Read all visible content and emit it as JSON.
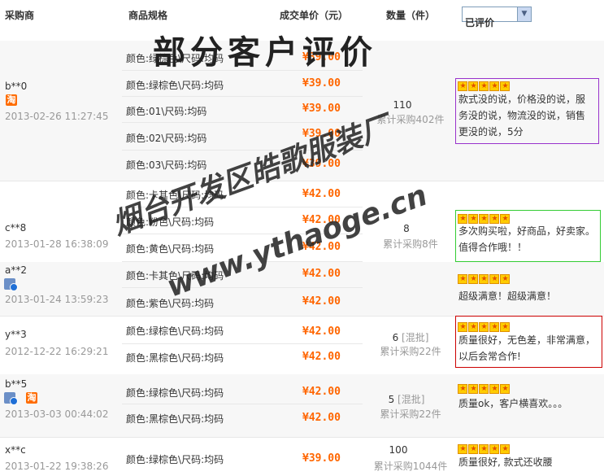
{
  "header": {
    "buyer": "采购商",
    "spec": "商品规格",
    "price": "成交单价（元）",
    "qty": "数量（件）",
    "filter_selected": "已评价"
  },
  "watermark": {
    "title": "部分客户评价",
    "line1": "烟台开发区皓歌服装厂",
    "line2": "www.ythaoge.cn"
  },
  "orders": [
    {
      "buyer": "b**0",
      "badge": "淘",
      "date": "2013-02-26 11:27:45",
      "items": [
        {
          "spec": "颜色:绿棕色\\尺码:均码",
          "price": "¥39.00"
        },
        {
          "spec": "颜色:绿棕色\\尺码:均码",
          "price": "¥39.00"
        },
        {
          "spec": "颜色:01\\尺码:均码",
          "price": "¥39.00"
        },
        {
          "spec": "颜色:02\\尺码:均码",
          "price": "¥39.00"
        },
        {
          "spec": "颜色:03\\尺码:均码",
          "price": "¥39.00"
        }
      ],
      "qty": "110",
      "cumulative": "累计采购402件",
      "comment": "款式没的说，价格没的说，服务没的说，物流没的说，销售更没的说，5分"
    },
    {
      "buyer": "c**8",
      "date": "2013-01-28 16:38:09",
      "items": [
        {
          "spec": "颜色:卡其色\\尺码:均码",
          "price": "¥42.00"
        },
        {
          "spec": "颜色:粉色\\尺码:均码",
          "price": "¥42.00"
        },
        {
          "spec": "颜色:黄色\\尺码:均码",
          "price": "¥42.00"
        }
      ],
      "qty": "8",
      "cumulative": "累计采购8件",
      "comment": "多次购买啦，好商品，好卖家。值得合作哦！！"
    },
    {
      "buyer": "a**2",
      "date": "2013-01-24 13:59:23",
      "items": [
        {
          "spec": "颜色:卡其色\\尺码:均码",
          "price": "¥42.00"
        },
        {
          "spec": "颜色:紫色\\尺码:均码",
          "price": "¥42.00"
        }
      ],
      "comment": "超级满意！超级满意！"
    },
    {
      "buyer": "y**3",
      "date": "2012-12-22 16:29:21",
      "items": [
        {
          "spec": "颜色:绿棕色\\尺码:均码",
          "price": "¥42.00"
        },
        {
          "spec": "颜色:黑棕色\\尺码:均码",
          "price": "¥42.00"
        }
      ],
      "qty": "6",
      "mixed": "[混批]",
      "cumulative": "累计采购22件",
      "comment": "质量很好，无色差，非常满意，以后会常合作!"
    },
    {
      "buyer": "b**5",
      "badge": "淘",
      "date": "2013-03-03 00:44:02",
      "items": [
        {
          "spec": "颜色:绿棕色\\尺码:均码",
          "price": "¥42.00"
        },
        {
          "spec": "颜色:黑棕色\\尺码:均码",
          "price": "¥42.00"
        }
      ],
      "qty": "5",
      "mixed": "[混批]",
      "cumulative": "累计采购22件",
      "comment": "质量ok，客户横喜欢。。。"
    },
    {
      "buyer": "x**c",
      "date": "2013-01-22 19:38:26",
      "items": [
        {
          "spec": "颜色:绿棕色\\尺码:均码",
          "price": "¥39.00"
        }
      ],
      "qty": "100",
      "cumulative": "累计采购1044件",
      "comment": "质量很好, 款式还收腰"
    }
  ],
  "colors": {
    "price": "#ff6600",
    "highlight1": "#9933cc",
    "highlight2": "#33cc33",
    "highlight3": "#cc0000"
  },
  "rating_stars": 5
}
